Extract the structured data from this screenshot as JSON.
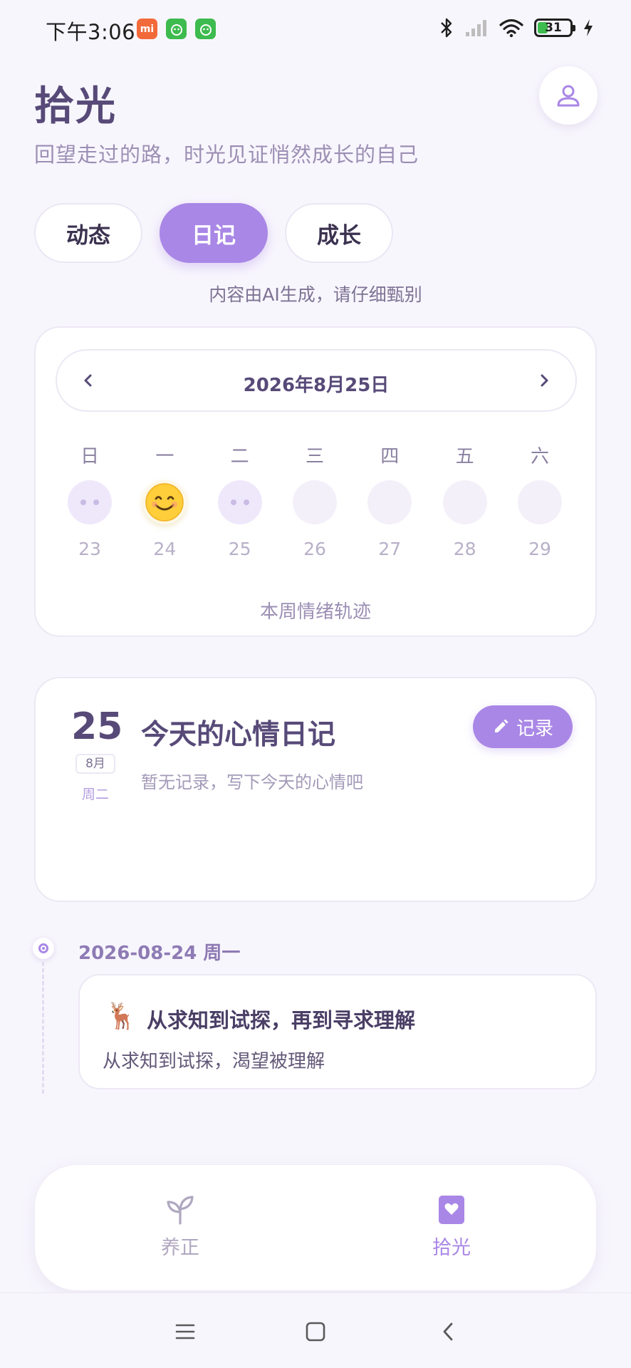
{
  "status_bar": {
    "time": "下午3:06",
    "notifications": [
      {
        "name": "mi-notification-icon",
        "glyph": "mi"
      },
      {
        "name": "app-notification-icon",
        "glyph": ""
      },
      {
        "name": "app-notification-icon-2",
        "glyph": ""
      }
    ],
    "battery_level": "31"
  },
  "header": {
    "title": "拾光",
    "subtitle": "回望走过的路，时光见证悄然成长的自己"
  },
  "tabs": [
    {
      "label": "动态",
      "active": false
    },
    {
      "label": "日记",
      "active": true
    },
    {
      "label": "成长",
      "active": false
    }
  ],
  "ai_note": "内容由AI生成，请仔细甄别",
  "calendar": {
    "current_date": "2026年8月25日",
    "weekdays": [
      "日",
      "一",
      "二",
      "三",
      "四",
      "五",
      "六"
    ],
    "days": [
      {
        "num": "23",
        "mood": "placeholder"
      },
      {
        "num": "24",
        "mood": "happy"
      },
      {
        "num": "25",
        "mood": "placeholder"
      },
      {
        "num": "26",
        "mood": "empty"
      },
      {
        "num": "27",
        "mood": "empty"
      },
      {
        "num": "28",
        "mood": "empty"
      },
      {
        "num": "29",
        "mood": "empty"
      }
    ],
    "caption": "本周情绪轨迹"
  },
  "diary": {
    "day": "25",
    "month": "8月",
    "weekday": "周二",
    "title": "今天的心情日记",
    "empty_text": "暂无记录，写下今天的心情吧",
    "record_label": "记录"
  },
  "timeline": {
    "date": "2026-08-24 周一",
    "entry": {
      "emoji": "🦌",
      "title": "从求知到试探，再到寻求理解",
      "text": "从求知到试探，渴望被理解"
    }
  },
  "bottom_nav": [
    {
      "label": "养正",
      "icon": "sprout-icon",
      "active": false
    },
    {
      "label": "拾光",
      "icon": "heart-bookmark-icon",
      "active": true
    }
  ],
  "colors": {
    "accent": "#a987e6",
    "title": "#574a78",
    "background": "#f8f6fd"
  }
}
